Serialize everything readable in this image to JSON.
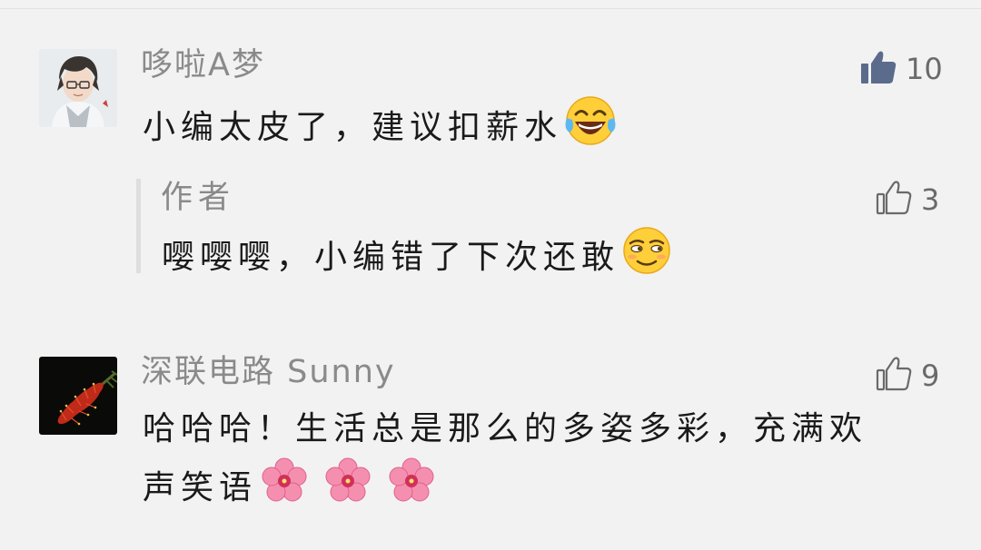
{
  "comments": [
    {
      "nickname": "哆啦A梦",
      "text": "小编太皮了，建议扣薪水",
      "emoji": "laughing-tears",
      "likes": "10",
      "liked": true,
      "reply": {
        "author_label": "作者",
        "text": "嘤嘤嘤，小编错了下次还敢",
        "emoji": "smirk-face",
        "likes": "3"
      }
    },
    {
      "nickname": "深联电路 Sunny",
      "text_line1": "哈哈哈！生活总是那么的多姿多彩，充满欢",
      "text_line2": "声笑语",
      "emoji": "hibiscus-flower",
      "likes": "9"
    }
  ],
  "colors": {
    "background": "#f2f2f2",
    "nickname": "#8a8a8a",
    "text": "#1a1a1a",
    "like_active": "#5b6b8c",
    "like_inactive": "#6a6a6a"
  }
}
